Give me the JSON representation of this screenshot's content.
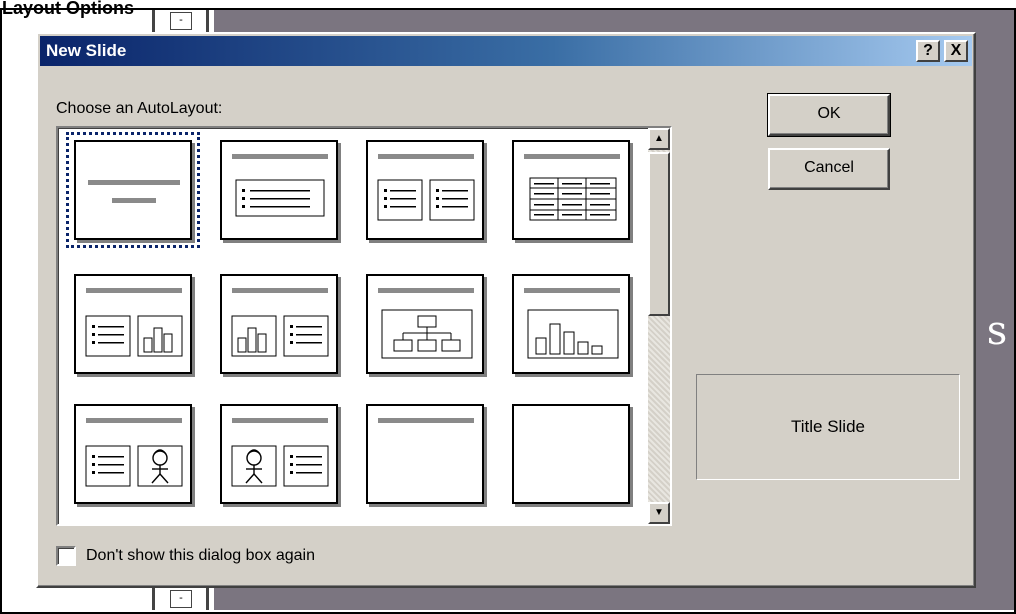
{
  "page": {
    "top_label": "Layout Options"
  },
  "background": {
    "slide_text": "t s"
  },
  "dialog": {
    "title": "New Slide",
    "help_glyph": "?",
    "close_glyph": "X",
    "prompt": "Choose an AutoLayout:",
    "ok_label": "OK",
    "cancel_label": "Cancel",
    "preview_label": "Title Slide",
    "checkbox_label": "Don't show this dialog box again",
    "checkbox_checked": false,
    "selected_layout": "Title Slide"
  },
  "layouts": [
    {
      "name": "title-slide",
      "icon": "title-slide-layout"
    },
    {
      "name": "bulleted-list",
      "icon": "bulleted-list-layout"
    },
    {
      "name": "two-column-text",
      "icon": "two-column-text-layout"
    },
    {
      "name": "table",
      "icon": "table-layout"
    },
    {
      "name": "text-and-chart",
      "icon": "text-chart-layout"
    },
    {
      "name": "chart-and-text",
      "icon": "chart-text-layout"
    },
    {
      "name": "organization-chart",
      "icon": "org-chart-layout"
    },
    {
      "name": "chart",
      "icon": "chart-layout"
    },
    {
      "name": "text-and-clip-art",
      "icon": "text-clipart-layout"
    },
    {
      "name": "clip-art-and-text",
      "icon": "clipart-text-layout"
    },
    {
      "name": "title-only",
      "icon": "title-only-layout"
    },
    {
      "name": "blank",
      "icon": "blank-layout"
    }
  ]
}
